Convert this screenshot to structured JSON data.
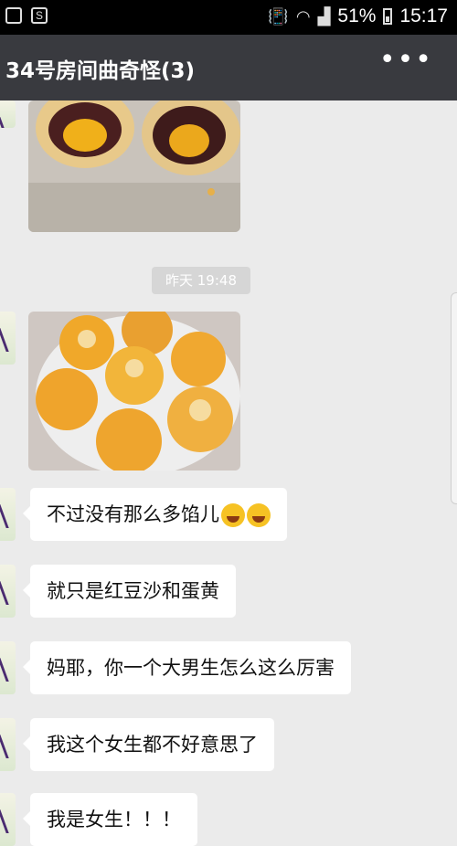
{
  "status_bar": {
    "battery": "51%",
    "time": "15:17"
  },
  "header": {
    "title": "34号房间曲奇怪(3)",
    "more": "•••"
  },
  "chat": {
    "timestamp": "昨天 19:48",
    "messages": [
      "不过没有那么多馅儿",
      "就只是红豆沙和蛋黄",
      "妈耶，你一个大男生怎么这么厉害",
      "我这个女生都不好意思了",
      "我是女生！！！"
    ]
  },
  "icons": [
    "sim-icon",
    "app-icon",
    "vibrate-icon",
    "wifi-icon",
    "signal-icon",
    "battery-icon",
    "more-icon",
    "laugh-cry-emoji-icon"
  ]
}
